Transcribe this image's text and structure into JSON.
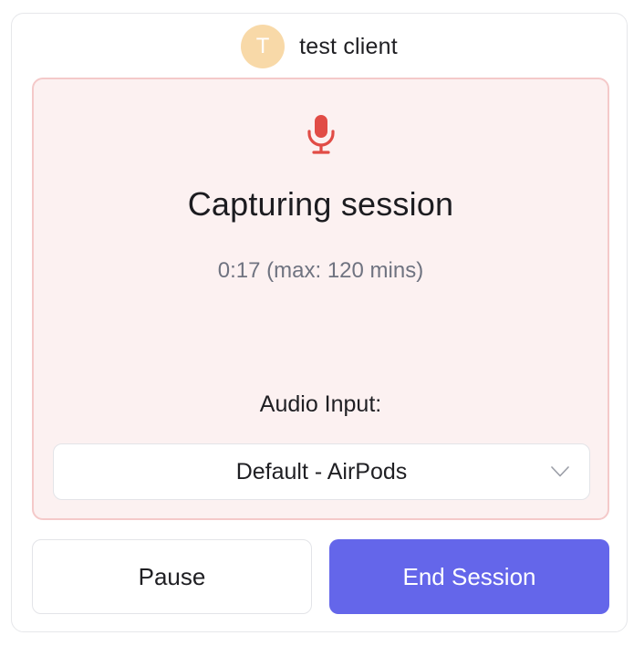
{
  "client": {
    "avatar_initial": "T",
    "name": "test client"
  },
  "capture": {
    "title": "Capturing session",
    "timer": "0:17 (max: 120 mins)",
    "audio_label": "Audio Input:",
    "audio_select": {
      "selected": "Default - AirPods"
    }
  },
  "actions": {
    "pause_label": "Pause",
    "end_label": "End Session"
  },
  "icons": {
    "mic": "microphone-icon",
    "chevron": "chevron-down-icon"
  },
  "colors": {
    "accent": "#6466ea",
    "mic_red": "#e14c46",
    "panel_bg": "#fcf1f1",
    "panel_border": "#f4c9c9",
    "avatar_bg": "#f8d9a8"
  }
}
